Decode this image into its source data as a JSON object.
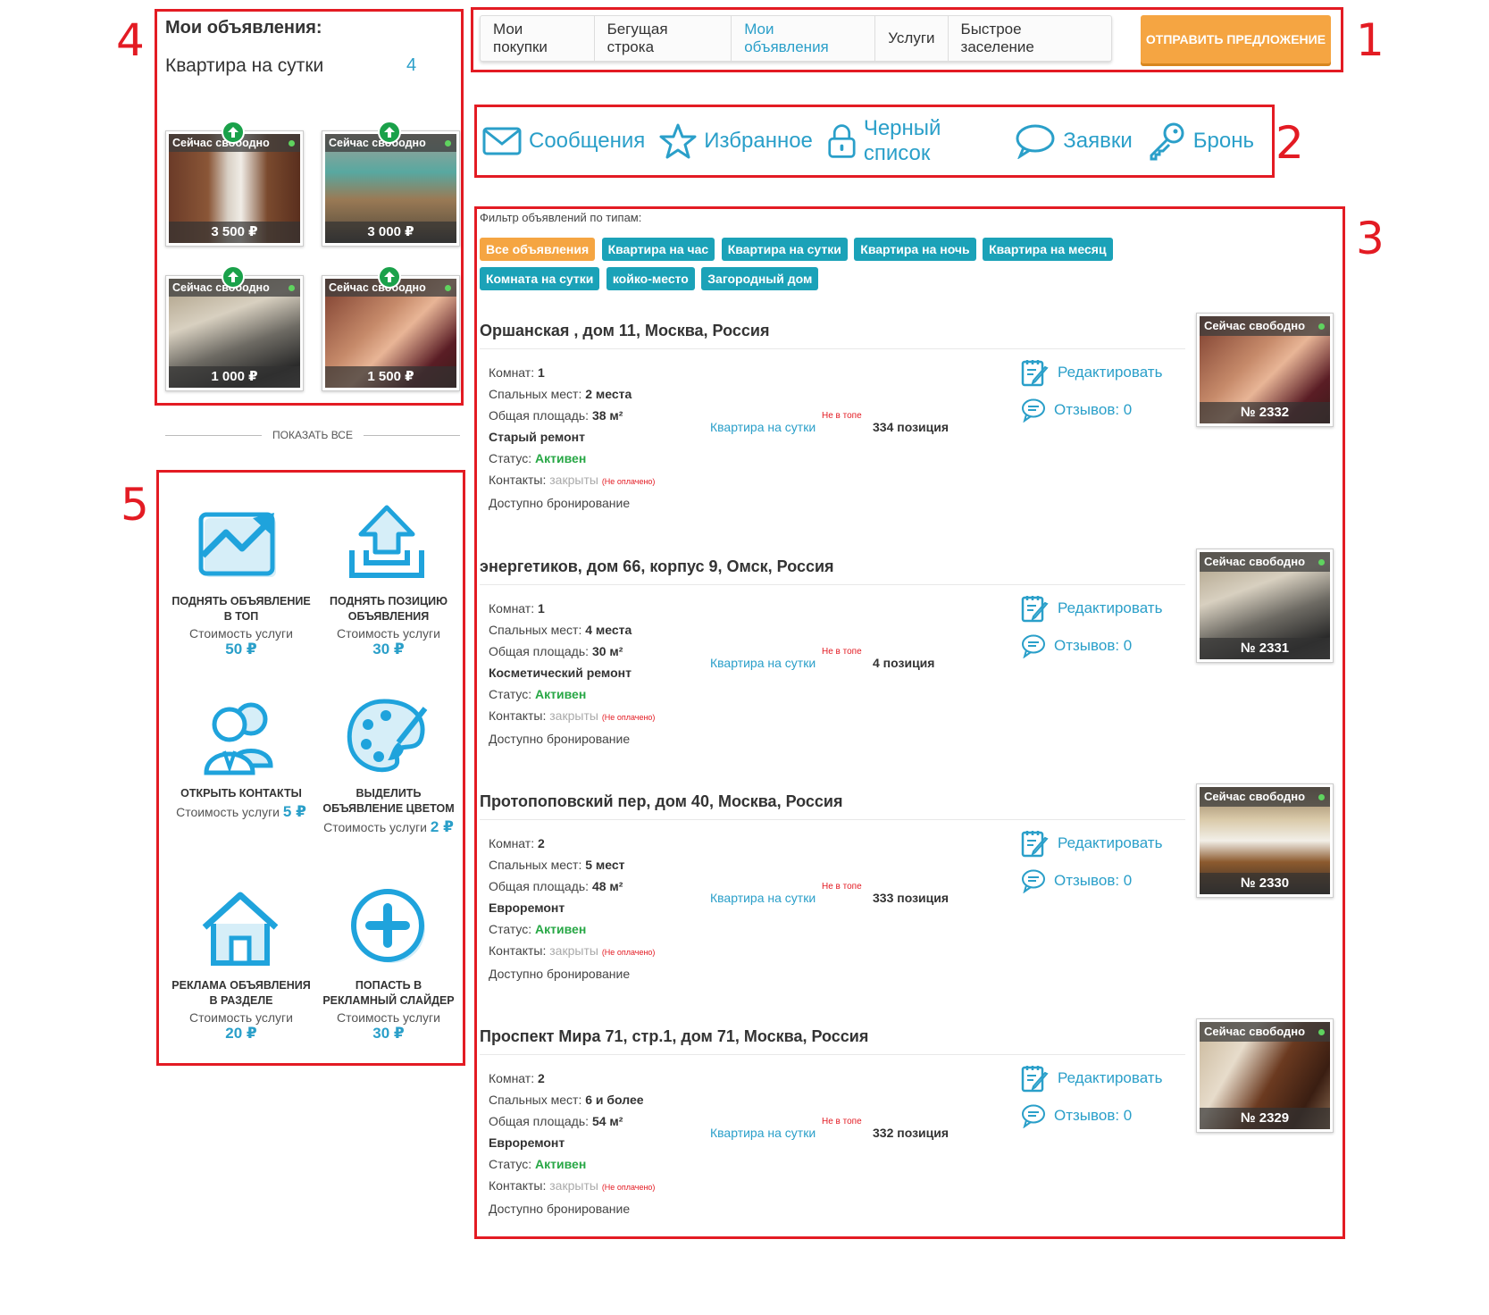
{
  "topnav": {
    "items": [
      "Мои покупки",
      "Бегущая строка",
      "Мои объявления",
      "Услуги",
      "Быстрое заселение"
    ],
    "offer_button": "ОТПРАВИТЬ ПРЕДЛОЖЕНИЕ"
  },
  "iconrow": {
    "messages": "Сообщения",
    "favorites": "Избранное",
    "blacklist": "Черный список",
    "requests": "Заявки",
    "booking": "Бронь"
  },
  "markers": [
    "1",
    "2",
    "3",
    "4",
    "5"
  ],
  "filter": {
    "label": "Фильтр объявлений по типам:",
    "chips": [
      "Все объявления",
      "Квартира на час",
      "Квартира на сутки",
      "Квартира на ночь",
      "Квартира на месяц",
      "Комната на сутки",
      "койко-место",
      "Загородный дом"
    ]
  },
  "labels": {
    "rooms": "Комнат:",
    "beds": "Спальных мест:",
    "area": "Общая площадь:",
    "status": "Статус:",
    "contacts": "Контакты:",
    "contacts_closed": "закрыты",
    "not_paid": "(Не оплачено)",
    "booking_available": "Доступно бронирование",
    "not_top": "Не в топе",
    "edit": "Редактировать",
    "reviews": "Отзывов: 0",
    "now_free": "Сейчас свободно"
  },
  "listings": [
    {
      "address": "Оршанская , дом 11, Москва, Россия",
      "rooms": "1",
      "beds": "2 места",
      "area": "38 м²",
      "repair": "Старый ремонт",
      "status": "Активен",
      "type": "Квартира на сутки",
      "position": "334 позиция",
      "number": "№ 2332"
    },
    {
      "address": "энергетиков, дом 66, корпус 9, Омск, Россия",
      "rooms": "1",
      "beds": "4 места",
      "area": "30 м²",
      "repair": "Косметический ремонт",
      "status": "Активен",
      "type": "Квартира на сутки",
      "position": "4 позиция",
      "number": "№ 2331"
    },
    {
      "address": "Протопоповский пер, дом 40, Москва, Россия",
      "rooms": "2",
      "beds": "5 мест",
      "area": "48 м²",
      "repair": "Евроремонт",
      "status": "Активен",
      "type": "Квартира на сутки",
      "position": "333 позиция",
      "number": "№ 2330"
    },
    {
      "address": "Проспект Мира 71, стр.1, дом 71, Москва, Россия",
      "rooms": "2",
      "beds": "6 и более",
      "area": "54 м²",
      "repair": "Евроремонт",
      "status": "Активен",
      "type": "Квартира на сутки",
      "position": "332 позиция",
      "number": "№ 2329"
    }
  ],
  "my_listings": {
    "title": "Мои объявления:",
    "category": "Квартира на сутки",
    "count": "4",
    "thumbs": [
      {
        "status": "Сейчас свободно",
        "price": "3 500 ₽"
      },
      {
        "status": "Сейчас свободно",
        "price": "3 000 ₽"
      },
      {
        "status": "Сейчас свободно",
        "price": "1 000 ₽"
      },
      {
        "status": "Сейчас свободно",
        "price": "1 500 ₽"
      }
    ],
    "show_all": "ПОКАЗАТЬ ВСЕ"
  },
  "services": [
    {
      "name_1": "ПОДНЯТЬ ОБЪЯВЛЕНИЕ",
      "name_2": "В ТОП",
      "cost": "Стоимость услуги",
      "price": "50 ₽",
      "icon": "chart-up-icon"
    },
    {
      "name_1": "ПОДНЯТЬ ПОЗИЦИЮ",
      "name_2": "ОБЪЯВЛЕНИЯ",
      "cost": "Стоимость услуги",
      "price": "30 ₽",
      "icon": "tray-upload-icon"
    },
    {
      "name_1": "ОТКРЫТЬ КОНТАКТЫ",
      "name_2": "",
      "cost": "Стоимость услуги",
      "price": "5 ₽",
      "icon": "users-icon"
    },
    {
      "name_1": "ВЫДЕЛИТЬ",
      "name_2": "ОБЪЯВЛЕНИЕ ЦВЕТОМ",
      "cost": "Стоимость услуги",
      "price": "2 ₽",
      "icon": "palette-icon"
    },
    {
      "name_1": "РЕКЛАМА ОБЪЯВЛЕНИЯ",
      "name_2": "В РАЗДЕЛЕ",
      "cost": "Стоимость услуги",
      "price": "20 ₽",
      "icon": "house-icon"
    },
    {
      "name_1": "ПОПАСТЬ В",
      "name_2": "РЕКЛАМНЫЙ СЛАЙДЕР",
      "cost": "Стоимость услуги",
      "price": "30 ₽",
      "icon": "plus-circle-icon"
    }
  ],
  "colors": {
    "accent": "#2a9fc9",
    "chip": "#1ba2b8",
    "orange": "#f5a542",
    "annotation_red": "#e31b23",
    "status_green": "#27a745"
  }
}
